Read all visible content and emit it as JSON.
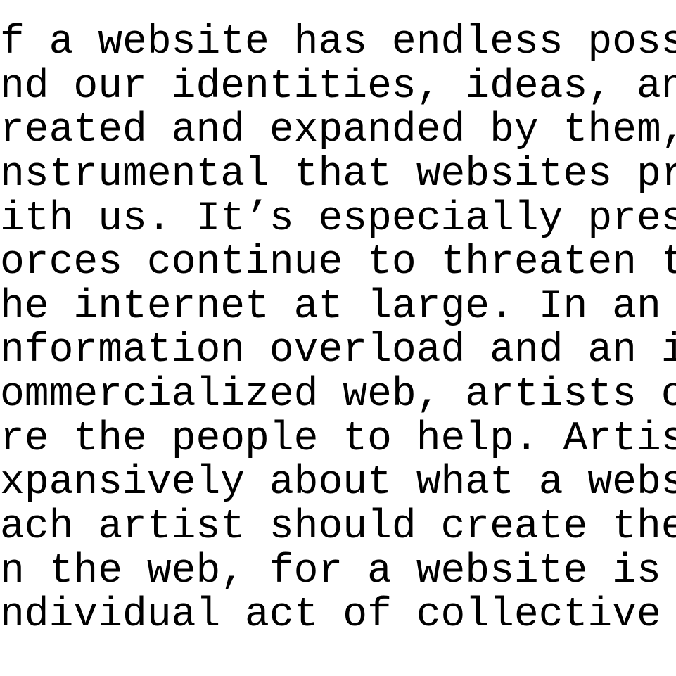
{
  "content": {
    "lines": [
      "f a website has endless possibiliti",
      "nd our identities, ideas, and dream",
      "reated and expanded by them, then i",
      "nstrumental that websites progress",
      "ith us. It’s especially pressing wh",
      "orces continue to threaten the web",
      "he internet at large. In an age of",
      "nformation overload and an increasi",
      "ommercialized web, artists of all t",
      "re the people to help. Artists can",
      "xpansively about what a website can",
      "ach artist should create their own",
      "n the web, for a website is an",
      "ndividual act of collective ambitio"
    ]
  }
}
